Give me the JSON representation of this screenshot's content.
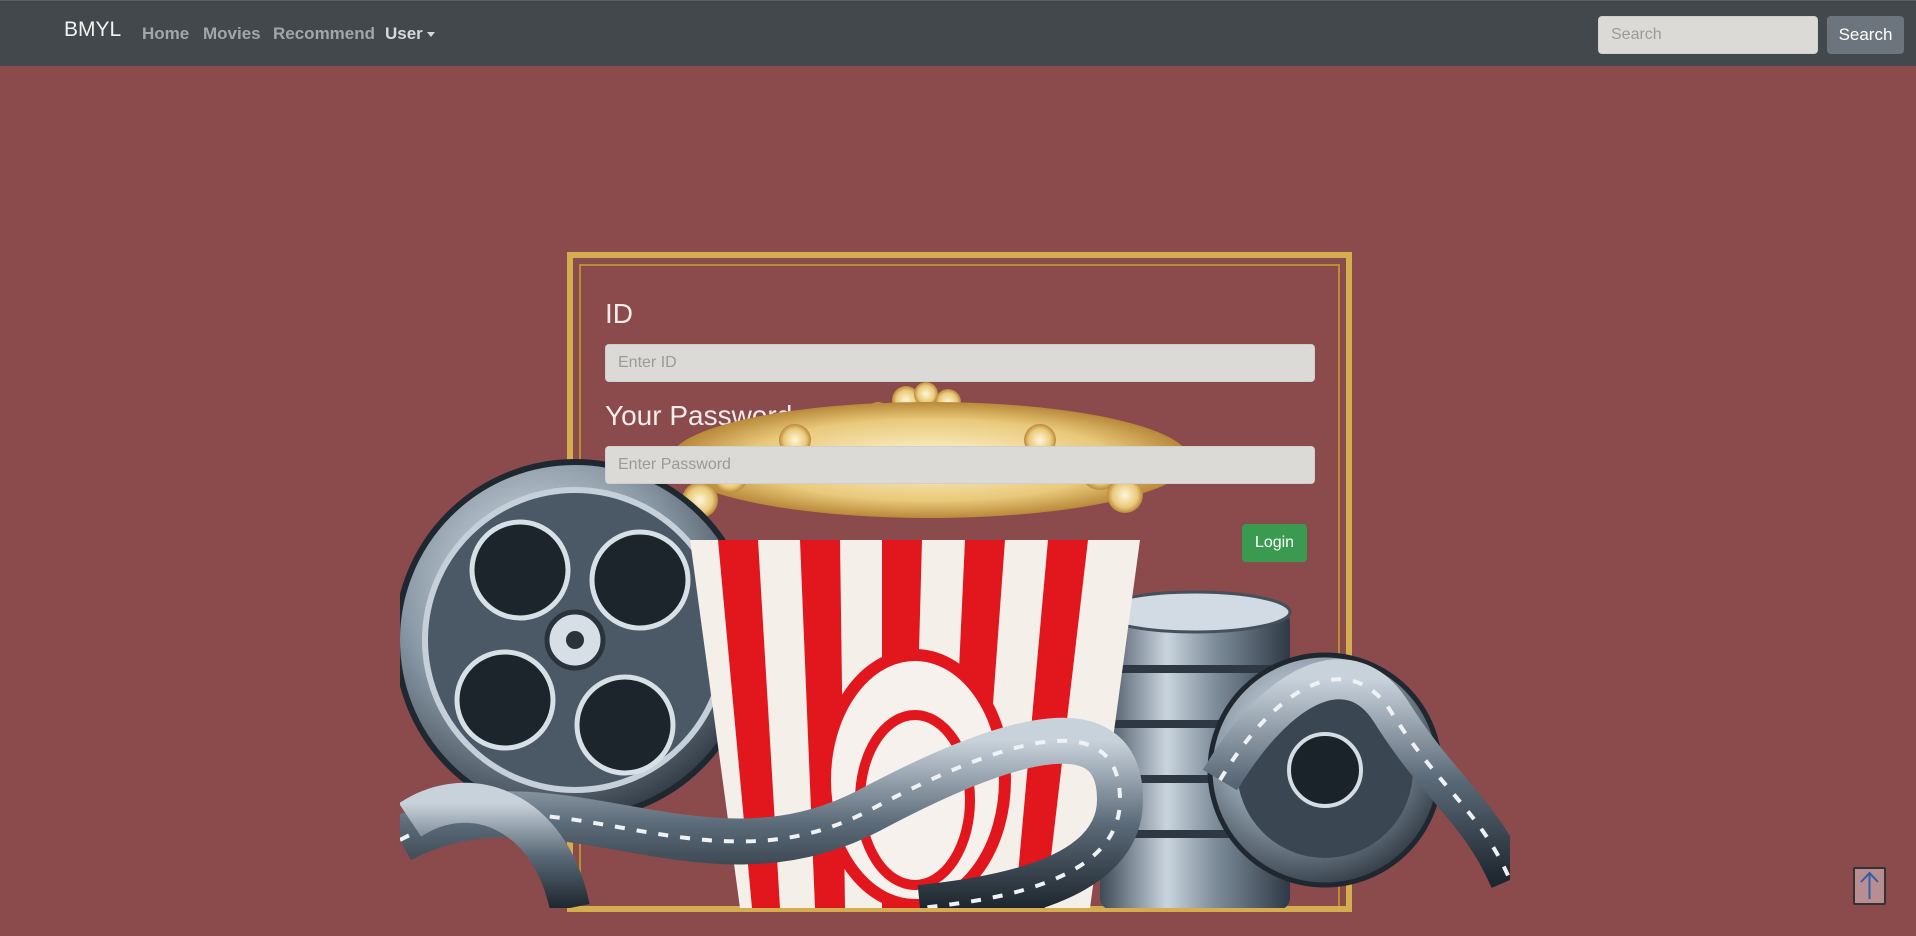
{
  "navbar": {
    "brand": "BMYL",
    "links": [
      {
        "label": "Home"
      },
      {
        "label": "Movies"
      },
      {
        "label": "Recommend"
      },
      {
        "label": "User"
      }
    ],
    "search": {
      "placeholder": "Search",
      "button_label": "Search"
    }
  },
  "login": {
    "id_label": "ID",
    "id_placeholder": "Enter ID",
    "password_label": "Your Password",
    "password_placeholder": "Enter Password",
    "login_button": "Login"
  },
  "icons": {
    "scroll_top": "arrow-up-icon",
    "user_dropdown": "caret-down-icon"
  },
  "colors": {
    "background": "#8b4a4b",
    "navbar": "#43484c",
    "frame_gold": "#d4ad4e",
    "login_button": "#3a9a50",
    "search_button": "#6c757d"
  }
}
